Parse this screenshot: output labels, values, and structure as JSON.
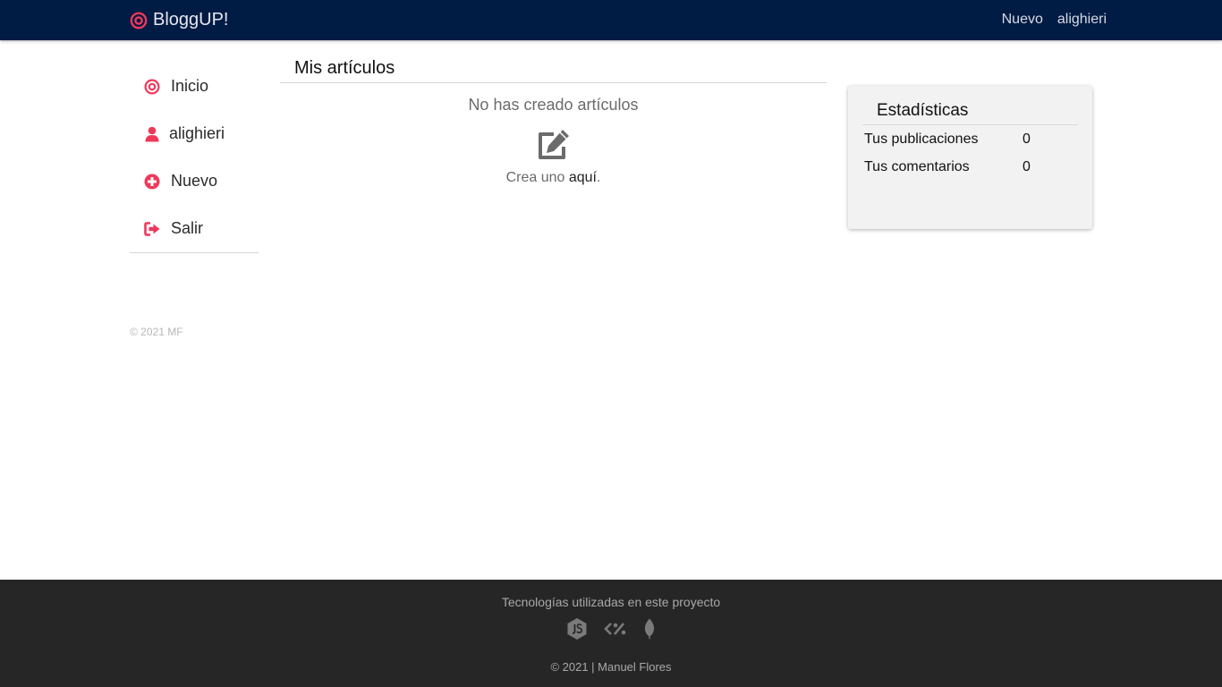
{
  "navbar": {
    "brand": "BloggUP!",
    "links": [
      "Nuevo",
      "alighieri"
    ]
  },
  "sidebar": {
    "items": [
      {
        "label": "Inicio",
        "icon": "target-icon"
      },
      {
        "label": "alighieri",
        "icon": "user-icon"
      },
      {
        "label": "Nuevo",
        "icon": "plus-circle-icon"
      },
      {
        "label": "Salir",
        "icon": "sign-out-icon"
      }
    ],
    "footer": "© 2021 MF"
  },
  "main": {
    "title": "Mis artículos",
    "empty_text": "No has creado artículos",
    "create_prefix": "Crea uno",
    "create_link": "aquí",
    "create_suffix": "."
  },
  "stats": {
    "title": "Estadísticas",
    "rows": [
      {
        "label": "Tus publicaciones",
        "value": "0"
      },
      {
        "label": "Tus comentarios",
        "value": "0"
      }
    ]
  },
  "footer": {
    "title": "Tecnologías utilizadas en este proyecto",
    "tech_icons": [
      "nodejs-icon",
      "ejs-icon",
      "mongodb-leaf-icon"
    ],
    "copyright": "© 2021 | Manuel Flores"
  },
  "colors": {
    "navbar_bg": "#001b44",
    "accent": "#f0385a",
    "footer_bg": "#262626",
    "card_bg": "#f2f2f2"
  }
}
